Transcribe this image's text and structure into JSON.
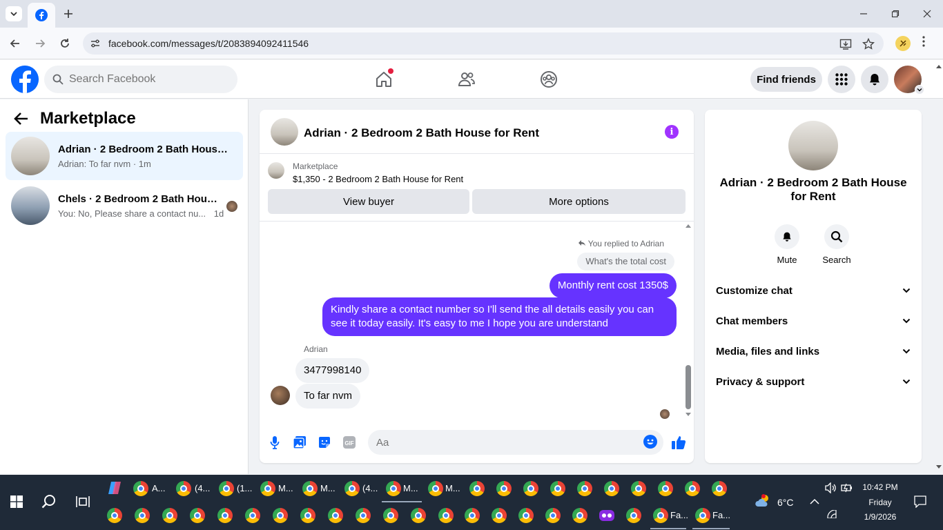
{
  "browser": {
    "url": "facebook.com/messages/t/2083894092411546"
  },
  "fb_header": {
    "search_placeholder": "Search Facebook",
    "find_friends": "Find friends"
  },
  "left_panel": {
    "title": "Marketplace",
    "conversations": [
      {
        "title": "Adrian · 2 Bedroom 2 Bath House for Rent",
        "snippet": "Adrian: To far nvm · 1m"
      },
      {
        "title": "Chels · 2 Bedroom 2 Bath House for Rent",
        "snippet": "You: No, Please share a contact nu...",
        "time": "1d"
      }
    ]
  },
  "chat": {
    "title": "Adrian · 2 Bedroom 2 Bath House for Rent",
    "listing_source": "Marketplace",
    "listing_desc": "$1,350 - 2 Bedroom 2 Bath House for Rent",
    "view_buyer": "View buyer",
    "more_options": "More options",
    "replied_note": "You replied to Adrian",
    "quoted_text": "What's the total cost",
    "out_msg_1": "Monthly rent cost 1350$",
    "out_msg_2": "Kindly share a contact number so I'll send the all details easily you can see it today easily. It's easy to me I hope you are understand",
    "sender_name": "Adrian",
    "in_msg_1": "3477998140",
    "in_msg_2": "To far nvm",
    "input_placeholder": "Aa",
    "accent_color": "#6633ff"
  },
  "right_panel": {
    "name": "Adrian · 2 Bedroom 2 Bath House for Rent",
    "mute": "Mute",
    "search": "Search",
    "rows": [
      "Customize chat",
      "Chat members",
      "Media, files and links",
      "Privacy & support"
    ]
  },
  "taskbar": {
    "apps_row1": [
      "A...",
      "(4...",
      "(1...",
      "M...",
      "M...",
      "(4...",
      "M...",
      "M..."
    ],
    "apps_row2": [
      "Fa...",
      "Fa..."
    ],
    "weather": "6°C",
    "time": "10:42 PM",
    "day": "Friday",
    "date": "1/9/2026"
  }
}
